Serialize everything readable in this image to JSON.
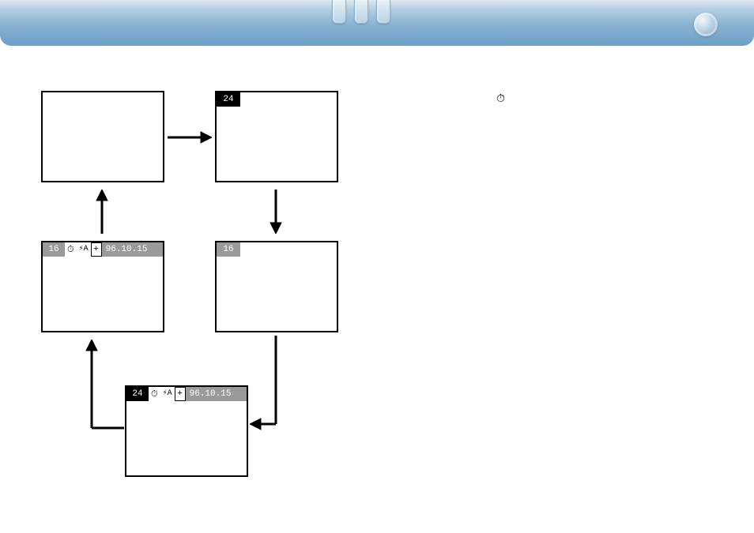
{
  "screens": {
    "s2_count": "24",
    "s3": {
      "count": "16",
      "timer": "⏱",
      "flash": "⚡A",
      "plus": "+",
      "date": "96.10.15"
    },
    "s4_count": "16",
    "s5": {
      "count": "24",
      "timer": "⏱",
      "flash": "⚡A",
      "plus": "+",
      "date": "96.10.15"
    }
  },
  "side_icon": "⏱"
}
